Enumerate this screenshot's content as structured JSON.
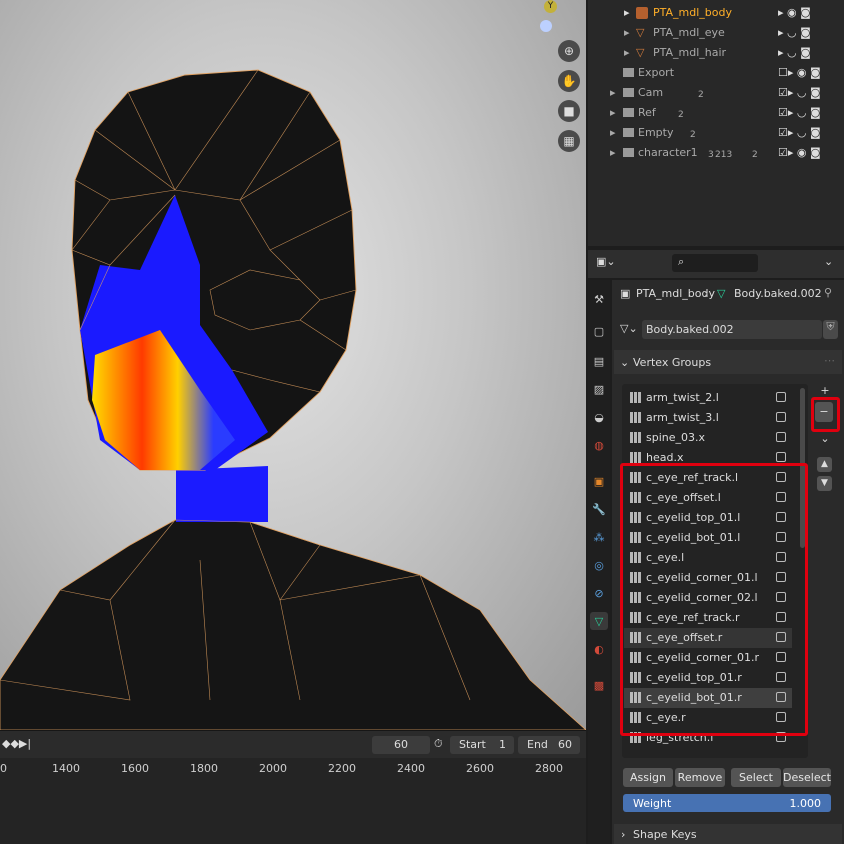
{
  "viewport": {
    "nav_icons": [
      "zoom-icon",
      "hand-icon",
      "camera-icon",
      "grid-icon"
    ]
  },
  "timeline": {
    "current_frame": "60",
    "start_label": "Start",
    "start_value": "1",
    "end_label": "End",
    "end_value": "60",
    "ticks": [
      "0",
      "1400",
      "1600",
      "1800",
      "2000",
      "2200",
      "2400",
      "2600",
      "2800"
    ]
  },
  "outliner": {
    "rows": [
      {
        "label": "PTA_mdl_body",
        "active": true
      },
      {
        "label": "PTA_mdl_eye",
        "active": false
      },
      {
        "label": "PTA_mdl_hair",
        "active": false
      },
      {
        "label": "Export",
        "active": false
      },
      {
        "label": "Cam",
        "count": "2"
      },
      {
        "label": "Ref",
        "count": "2"
      },
      {
        "label": "Empty",
        "count": "2"
      },
      {
        "label": "character1",
        "count_a": "3",
        "count_b": "213",
        "count_c": "2"
      }
    ]
  },
  "properties": {
    "breadcrumb_object": "PTA_mdl_body",
    "breadcrumb_data": "Body.baked.002",
    "mesh_name": "Body.baked.002",
    "section_vertex_groups": "Vertex Groups",
    "vertex_groups": [
      "arm_twist_2.l",
      "arm_twist_3.l",
      "spine_03.x",
      "head.x",
      "c_eye_ref_track.l",
      "c_eye_offset.l",
      "c_eyelid_top_01.l",
      "c_eyelid_bot_01.l",
      "c_eye.l",
      "c_eyelid_corner_01.l",
      "c_eyelid_corner_02.l",
      "c_eye_ref_track.r",
      "c_eye_offset.r",
      "c_eyelid_corner_01.r",
      "c_eyelid_top_01.r",
      "c_eyelid_bot_01.r",
      "c_eye.r",
      "leg_stretch.l"
    ],
    "selected_group": "c_eyelid_bot_01.r",
    "buttons": {
      "assign": "Assign",
      "remove": "Remove",
      "select": "Select",
      "deselect": "Deselect"
    },
    "weight_label": "Weight",
    "weight_value": "1.000",
    "section_shape_keys": "Shape Keys"
  },
  "colors": {
    "highlight": "#e0000f",
    "accent": "#4772b3",
    "active_text": "#ffaf29"
  }
}
